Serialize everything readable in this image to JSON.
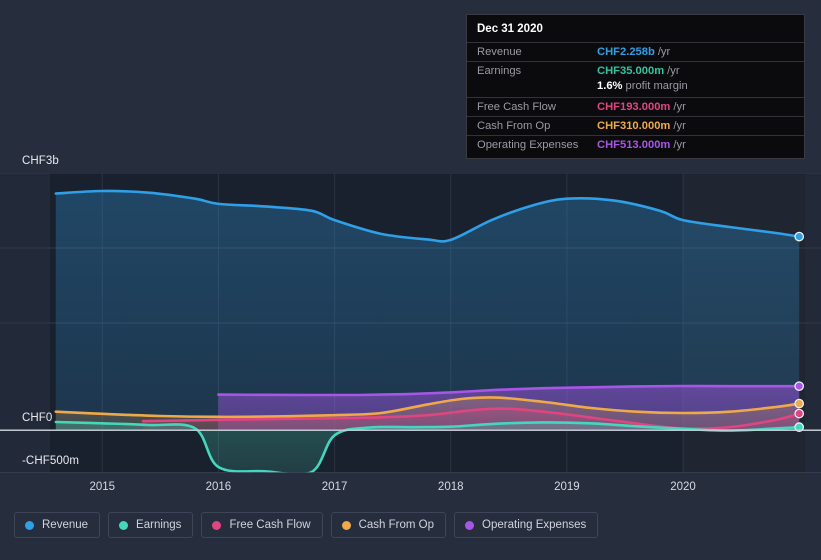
{
  "chart_data": {
    "type": "area",
    "title": "",
    "xlabel": "",
    "ylabel": "",
    "currency": "CHF",
    "grid": true,
    "legend_position": "bottom-left",
    "xlim": [
      2014.55,
      2021.05
    ],
    "ylim": [
      -500,
      3000
    ],
    "yunit": "millions CHF",
    "yticks": [
      {
        "value": 3000,
        "label": "CHF3b"
      },
      {
        "value": 2125,
        "label": ""
      },
      {
        "value": 1250,
        "label": ""
      },
      {
        "value": 0,
        "label": "CHF0"
      },
      {
        "value": -500,
        "label": "-CHF500m"
      }
    ],
    "xticks": [
      {
        "value": 2015,
        "label": "2015"
      },
      {
        "value": 2016,
        "label": "2016"
      },
      {
        "value": 2017,
        "label": "2017"
      },
      {
        "value": 2018,
        "label": "2018"
      },
      {
        "value": 2019,
        "label": "2019"
      },
      {
        "value": 2020,
        "label": "2020"
      }
    ],
    "forecast_region_start": 2020.0,
    "series": [
      {
        "name": "Revenue",
        "color": "#2f9fe8",
        "x": [
          2014.6,
          2015.0,
          2015.4,
          2015.8,
          2016.0,
          2016.4,
          2016.8,
          2017.0,
          2017.4,
          2017.8,
          2018.0,
          2018.35,
          2018.7,
          2019.0,
          2019.4,
          2019.8,
          2020.0,
          2020.4,
          2020.8,
          2021.0
        ],
        "values": [
          2760,
          2790,
          2770,
          2700,
          2640,
          2610,
          2560,
          2450,
          2290,
          2225,
          2220,
          2450,
          2620,
          2700,
          2680,
          2560,
          2450,
          2370,
          2300,
          2258
        ]
      },
      {
        "name": "Earnings",
        "color": "#45d7bb",
        "x": [
          2014.6,
          2015.0,
          2015.4,
          2015.8,
          2016.0,
          2016.4,
          2016.8,
          2017.0,
          2017.3,
          2017.7,
          2018.0,
          2018.4,
          2018.8,
          2019.2,
          2019.6,
          2020.0,
          2020.4,
          2020.8,
          2021.0
        ],
        "values": [
          95,
          80,
          60,
          20,
          -430,
          -480,
          -490,
          -60,
          30,
          35,
          40,
          75,
          90,
          80,
          45,
          15,
          -5,
          20,
          35
        ]
      },
      {
        "name": "Free Cash Flow",
        "color": "#e0457f",
        "x": [
          2015.35,
          2015.8,
          2016.0,
          2016.5,
          2017.0,
          2017.4,
          2017.8,
          2018.2,
          2018.5,
          2018.9,
          2019.3,
          2019.7,
          2020.0,
          2020.4,
          2020.8,
          2021.0
        ],
        "values": [
          105,
          115,
          120,
          130,
          140,
          150,
          175,
          235,
          250,
          200,
          130,
          60,
          20,
          35,
          120,
          193
        ]
      },
      {
        "name": "Cash From Op",
        "color": "#efa94a",
        "x": [
          2014.6,
          2015.0,
          2015.5,
          2016.0,
          2016.5,
          2017.0,
          2017.4,
          2017.8,
          2018.1,
          2018.4,
          2018.8,
          2019.2,
          2019.6,
          2020.0,
          2020.4,
          2020.8,
          2021.0
        ],
        "values": [
          215,
          190,
          165,
          155,
          160,
          175,
          200,
          300,
          365,
          380,
          330,
          260,
          215,
          200,
          215,
          270,
          310
        ]
      },
      {
        "name": "Operating Expenses",
        "color": "#a855e8",
        "x": [
          2016.0,
          2016.4,
          2016.8,
          2017.2,
          2017.6,
          2018.0,
          2018.4,
          2018.8,
          2019.2,
          2019.6,
          2020.0,
          2020.4,
          2020.8,
          2021.0
        ],
        "values": [
          415,
          412,
          410,
          410,
          420,
          440,
          470,
          490,
          500,
          510,
          515,
          513,
          513,
          513
        ]
      }
    ]
  },
  "tooltip": {
    "date": "Dec 31 2020",
    "rows": [
      {
        "key": "Revenue",
        "value": "CHF2.258b",
        "unit": "/yr",
        "color": "#2f9fe8"
      },
      {
        "key": "Earnings",
        "value": "CHF35.000m",
        "unit": "/yr",
        "color": "#2ec4a0"
      },
      {
        "key": "",
        "value": "1.6%",
        "unit": "profit margin",
        "color": "#ffffff"
      },
      {
        "key": "Free Cash Flow",
        "value": "CHF193.000m",
        "unit": "/yr",
        "color": "#e0457f"
      },
      {
        "key": "Cash From Op",
        "value": "CHF310.000m",
        "unit": "/yr",
        "color": "#efa94a"
      },
      {
        "key": "Operating Expenses",
        "value": "CHF513.000m",
        "unit": "/yr",
        "color": "#a855e8"
      }
    ]
  },
  "legend": {
    "items": [
      {
        "label": "Revenue",
        "color": "#2f9fe8"
      },
      {
        "label": "Earnings",
        "color": "#45d7bb"
      },
      {
        "label": "Free Cash Flow",
        "color": "#e0457f"
      },
      {
        "label": "Cash From Op",
        "color": "#efa94a"
      },
      {
        "label": "Operating Expenses",
        "color": "#a855e8"
      }
    ]
  },
  "axis": {
    "y_top_label": "CHF3b",
    "y_zero_label": "CHF0",
    "y_bottom_label": "-CHF500m"
  }
}
